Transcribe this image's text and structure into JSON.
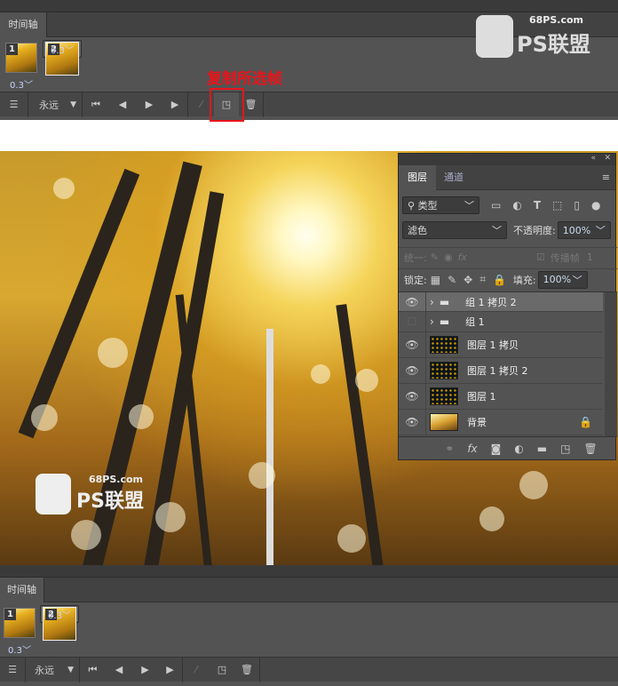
{
  "timeline_top": {
    "tab": "时间轴",
    "frames": [
      {
        "num": "1",
        "delay": "0.3"
      },
      {
        "num": "2",
        "delay": "0.3"
      }
    ],
    "loop": "永远"
  },
  "annotation": "复制所选帧",
  "watermark": {
    "site": "68PS.com",
    "brand": "PS联盟"
  },
  "layers_panel": {
    "tabs": [
      "图层",
      "通道"
    ],
    "filter": "类型",
    "blend_mode": "滤色",
    "opacity_label": "不透明度:",
    "opacity": "100%",
    "unify_label": "统一:",
    "propagate_label": "传播帧",
    "propagate_value": "1",
    "lock_label": "锁定:",
    "fill_label": "填充:",
    "fill": "100%",
    "layers": [
      {
        "name": "组 1 拷贝 2",
        "type": "group",
        "visible": true,
        "selected": true
      },
      {
        "name": "组 1",
        "type": "group",
        "visible": false
      },
      {
        "name": "图层 1 拷贝",
        "type": "layer",
        "visible": true
      },
      {
        "name": "图层 1 拷贝 2",
        "type": "layer",
        "visible": true
      },
      {
        "name": "图层 1",
        "type": "layer",
        "visible": true
      },
      {
        "name": "背景",
        "type": "background",
        "visible": true,
        "locked": true
      }
    ]
  },
  "timeline_bottom": {
    "tab": "时间轴",
    "frames": [
      {
        "num": "1",
        "delay": "0.3"
      },
      {
        "num": "2",
        "delay": "0.3"
      }
    ],
    "loop": "永远"
  }
}
